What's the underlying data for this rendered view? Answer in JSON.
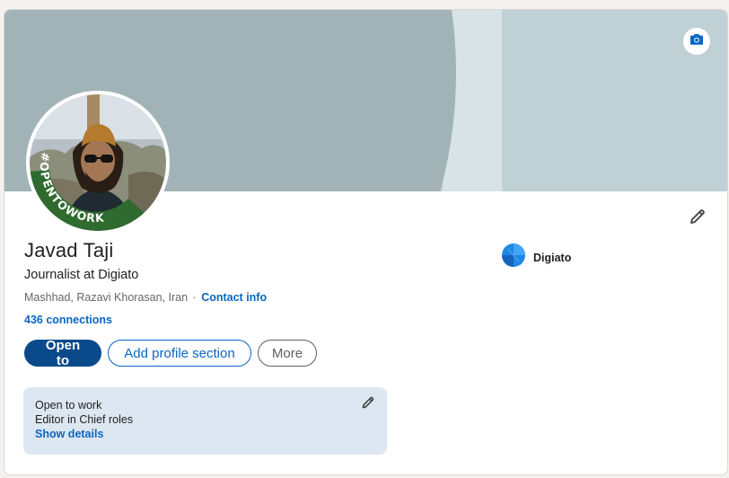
{
  "profile": {
    "name": "Javad Taji",
    "headline": "Journalist at Digiato",
    "location": "Mashhad, Razavi Khorasan, Iran",
    "location_separator": "·",
    "contact_info_label": "Contact info",
    "connections_label": "436 connections",
    "avatar_badge": "#OPENTOWORK"
  },
  "company": {
    "name": "Digiato"
  },
  "actions": {
    "open_to_label": "Open to",
    "add_section_label": "Add profile section",
    "more_label": "More"
  },
  "open_to_work": {
    "title": "Open to work",
    "roles": "Editor in Chief roles",
    "details_label": "Show details"
  },
  "icons": {
    "camera": "camera-icon",
    "edit": "pencil-icon"
  },
  "colors": {
    "brand_blue": "#0a66c2",
    "primary_button": "#0a4a8a",
    "opentowork_green": "#2f6b2f",
    "banner_dark": "#a2b3b7",
    "banner_light": "#c0d1d6",
    "open_to_work_bg": "#dde7f1"
  }
}
